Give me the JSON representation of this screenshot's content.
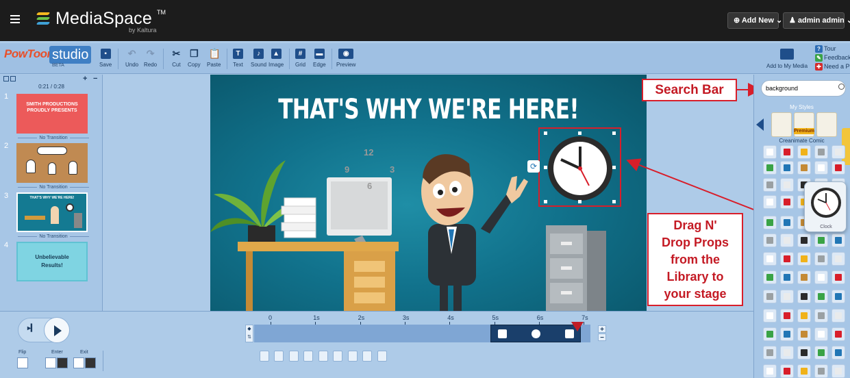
{
  "topbar": {
    "brand": "MediaSpace",
    "trademark": "TM",
    "byline": "by Kaltura",
    "add_new": "⊕ Add New ⌄",
    "user_menu": "♟ admin admin ⌄"
  },
  "toolbar": {
    "logo_powtoon": "PowToon",
    "logo_studio": "studio",
    "logo_beta": "BETA",
    "save": "Save",
    "undo": "Undo",
    "redo": "Redo",
    "cut": "Cut",
    "copy": "Copy",
    "paste": "Paste",
    "text": "Text",
    "sound": "Sound",
    "image": "Image",
    "grid": "Grid",
    "edge": "Edge",
    "preview": "Preview",
    "add_to_media": "Add to My Media",
    "tour": "Tour",
    "feedback": "Feedback",
    "need_help": "Need a Pr"
  },
  "slides_panel": {
    "time": "0:21 / 0:28",
    "add": "+",
    "remove": "−",
    "slides": [
      {
        "num": "1",
        "text_line1": "SMITH PRODUCTIONS",
        "text_line2": "PROUDLY PRESENTS",
        "transition": "No Transition"
      },
      {
        "num": "2",
        "transition": "No Transition"
      },
      {
        "num": "3",
        "text_line1": "THAT'S WHY WE'RE HERE!",
        "transition": "No Transition"
      },
      {
        "num": "4",
        "text_line1": "Unbelievable",
        "text_line2": "Results!"
      }
    ]
  },
  "stage": {
    "title": "THAT'S WHY WE'RE HERE!",
    "clock_numbers": [
      "12",
      "3",
      "6",
      "9"
    ]
  },
  "annotations": {
    "search_bar": "Search Bar",
    "drag_line1": "Drag N'",
    "drag_line2": "Drop Props",
    "drag_line3": "from the",
    "drag_line4": "Library to",
    "drag_line5": "your stage"
  },
  "library": {
    "search_value": "background",
    "my_styles": "My Styles",
    "style_name": "Creanimate Comic",
    "premium": "Premium",
    "preview_label": "Clock"
  },
  "timeline": {
    "ticks": [
      "0",
      "1s",
      "2s",
      "3s",
      "4s",
      "5s",
      "6s",
      "7s"
    ],
    "flip": "Flip",
    "enter": "Enter",
    "exit": "Exit"
  },
  "colors": {
    "accent_red": "#d81e2a",
    "toolbar_blue": "#1f4e8a",
    "stage_teal": "#11728c",
    "panel_blue": "#a7c6e6"
  }
}
